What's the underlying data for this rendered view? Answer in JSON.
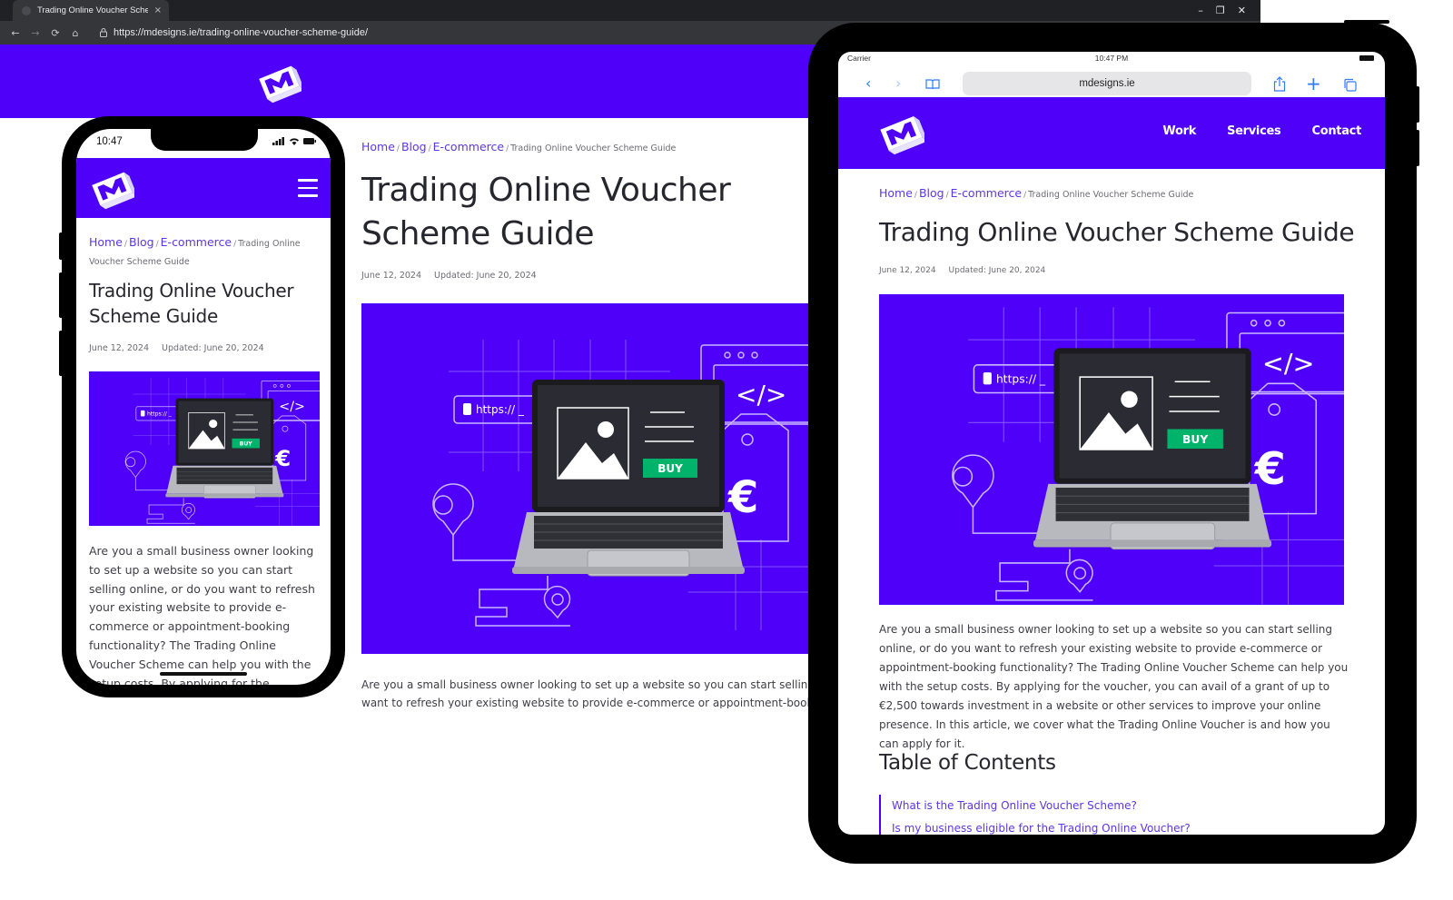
{
  "browser": {
    "tab_title": "Trading Online Voucher Scheme Guide",
    "tab_close": "×",
    "url": "https://mdesigns.ie/trading-online-voucher-scheme-guide/",
    "nav": {
      "back": "←",
      "forward": "→",
      "reload": "⟳",
      "home": "⌂"
    },
    "window_controls": {
      "minimize": "–",
      "restore": "❐",
      "close": "✕"
    }
  },
  "brand": {
    "accent": "#4f00f9",
    "buy_green": "#00b36b",
    "link": "#5c36e6"
  },
  "breadcrumb": {
    "items": [
      "Home",
      "Blog",
      "E-commerce"
    ],
    "separator": "/",
    "current": "Trading Online Voucher Scheme Guide"
  },
  "article": {
    "title": "Trading Online Voucher Scheme Guide",
    "published": "June 12, 2024",
    "updated": "Updated: June 20, 2024",
    "intro": "Are you a small business owner looking to set up a website so you can start selling online, or do you want to refresh your existing website to provide e-commerce or appointment-booking functionality? The Trading Online Voucher Scheme can help you with the setup costs. By applying for the voucher, you can avail of a grant of up to €2,500 towards investment in a website or other services to improve your online presence. In this article, we cover what the Trading Online Voucher is and how you can apply for it.",
    "desktop_intro_line1": "Are you a small business owner looking to set up a website so you can start selling online, or do you",
    "desktop_intro_line2": "want to refresh your existing website to provide e-commerce or appointment-booking functionality?"
  },
  "hero": {
    "url_chip": "https:// _",
    "buy_label": "BUY",
    "code_glyph": "</>",
    "currency": "€"
  },
  "phone": {
    "time": "10:47"
  },
  "tablet": {
    "carrier": "Carrier",
    "time": "10:47 PM",
    "address": "mdesigns.ie",
    "toolbar": {
      "back": "‹",
      "forward": "›",
      "bookmarks": "📖",
      "share": "⇪",
      "new_tab": "+",
      "tabs": "⧉"
    },
    "nav": [
      "Work",
      "Services",
      "Contact"
    ]
  },
  "toc": {
    "heading": "Table of Contents",
    "items": [
      "What is the Trading Online Voucher Scheme?",
      "Is my business eligible for the Trading Online Voucher?"
    ]
  }
}
